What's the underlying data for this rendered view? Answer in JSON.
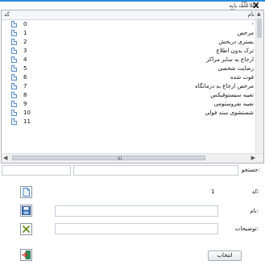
{
  "window": {
    "title": "اطلاعات پایه",
    "minimize": "_",
    "maximize": "☐",
    "close": "X"
  },
  "list": {
    "columns": {
      "code": "کد",
      "name": "نام"
    },
    "rows": [
      {
        "code": "0",
        "name": "-"
      },
      {
        "code": "1",
        "name": "مرخص"
      },
      {
        "code": "2",
        "name": "بستری دربخش"
      },
      {
        "code": "3",
        "name": "ترک بدون اطلاع"
      },
      {
        "code": "4",
        "name": "ارجاع به سایر مراکز"
      },
      {
        "code": "5",
        "name": "رضایت شخصی"
      },
      {
        "code": "6",
        "name": "فوت شده"
      },
      {
        "code": "7",
        "name": "مرخص ارجاع به درمانگاه"
      },
      {
        "code": "8",
        "name": "تعبیه سیستوفیکس"
      },
      {
        "code": "9",
        "name": "تعبیه نفروستومی"
      },
      {
        "code": "10",
        "name": "شستشوی سند فولی"
      },
      {
        "code": "11",
        "name": ""
      }
    ],
    "scroll_grip": "III"
  },
  "search": {
    "label": "جستجو:",
    "value": ""
  },
  "form": {
    "code_label": "کد:",
    "code_value": "1",
    "name_label": "نام:",
    "name_value": "",
    "desc_label": "توضیحات:",
    "desc_value": ""
  },
  "actions": {
    "select_label": "انتخاب"
  }
}
